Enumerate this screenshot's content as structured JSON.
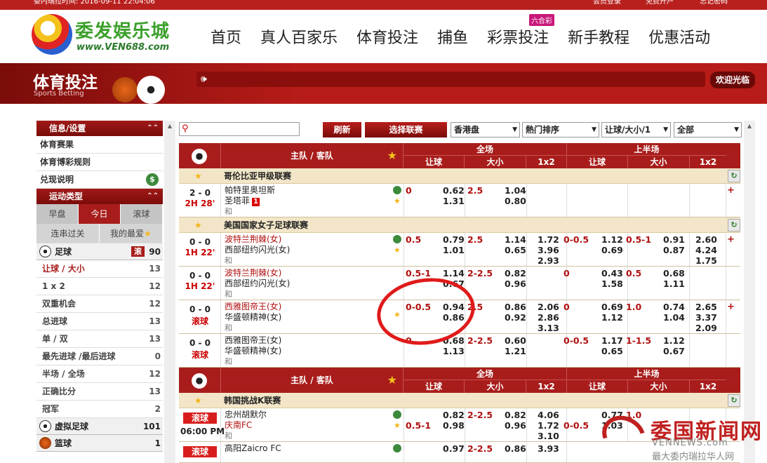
{
  "topbar": {
    "server_time": "委内瑞拉时间: 2016-09-11 22:04:06",
    "links": [
      "会员登录",
      "免费开户",
      "忘记密码"
    ]
  },
  "logo": {
    "name": "委发娱乐城",
    "url": "www.VEN688.com"
  },
  "nav": {
    "items": [
      "首页",
      "真人百家乐",
      "体育投注",
      "捕鱼",
      "彩票投注",
      "新手教程",
      "优惠活动"
    ],
    "badge": "六合彩"
  },
  "banner": {
    "title": "体育投注",
    "subtitle": "Sports Betting",
    "welcome": "欢迎光临"
  },
  "left": {
    "info_title": "信息/设置",
    "info_items": [
      "体育赛果",
      "体育博彩规则",
      "兑现说明"
    ],
    "sport_type_title": "运动类型",
    "tabs": [
      "早盘",
      "今日",
      "滚球"
    ],
    "tabs2": [
      "连串过关",
      "我的最爱"
    ],
    "football": {
      "label": "足球",
      "live_tag": "滚",
      "count": "90"
    },
    "bet_types": [
      {
        "label": "让球 / 大小",
        "count": "13"
      },
      {
        "label": "1 x 2",
        "count": "12"
      },
      {
        "label": "双重机会",
        "count": "12"
      },
      {
        "label": "总进球",
        "count": "13"
      },
      {
        "label": "单 / 双",
        "count": "13"
      },
      {
        "label": "最先进球 /最后进球",
        "count": "0"
      },
      {
        "label": "半场 / 全场",
        "count": "12"
      },
      {
        "label": "正确比分",
        "count": "13"
      },
      {
        "label": "冠军",
        "count": "2"
      }
    ],
    "virtual": {
      "label": "虚拟足球",
      "count": "101"
    },
    "basketball": {
      "label": "篮球",
      "count": "1"
    }
  },
  "toolbar": {
    "refresh": "刷新",
    "select_league": "选择联赛",
    "odds_type": "香港盘",
    "sort": "熱门排序",
    "market": "让球/大小/1",
    "filter": "全部"
  },
  "table": {
    "teams_header": "主队 / 客队",
    "full": "全场",
    "half": "上半场",
    "cols": [
      "让球",
      "大小",
      "1x2",
      "让球",
      "大小",
      "1x2"
    ]
  },
  "leagues": [
    {
      "name": "哥伦比亚甲级联赛"
    },
    {
      "name": "美国国家女子足球联赛"
    },
    {
      "name": "韩国挑战K联赛"
    }
  ],
  "matches": [
    {
      "score": "2 - 0",
      "time": "2H 28'",
      "home": "帕特里奥坦斯",
      "away": "圣塔菲",
      "red_card": "1",
      "draw": "和",
      "hdp_line": "0",
      "hdp_h": "0.62",
      "hdp_a": "1.31",
      "ou_line": "2.5",
      "ou_o": "1.04",
      "ou_u": "0.80"
    },
    {
      "score": "0 - 0",
      "time": "1H 22'",
      "home": "波特兰荆棘(女)",
      "away": "西部纽约闪光(女)",
      "draw": "和",
      "hdp_line": "0.5",
      "hdp_h": "0.79",
      "hdp_a": "1.01",
      "ou_line": "2.5",
      "ou_o": "1.14",
      "ou_u": "0.65",
      "x1": "1.72",
      "x2": "3.96",
      "xd": "2.93",
      "h_hdp_line": "0-0.5",
      "h_hdp_h": "1.12",
      "h_hdp_a": "0.69",
      "h_ou_line": "0.5-1",
      "h_ou_o": "0.91",
      "h_ou_u": "0.87",
      "h_x1": "2.60",
      "h_x2": "4.24",
      "h_xd": "1.75"
    },
    {
      "score": "0 - 0",
      "time": "1H 22'",
      "home": "波特兰荆棘(女)",
      "away": "西部纽约闪光(女)",
      "draw": "和",
      "hdp_line": "0.5-1",
      "hdp_h": "1.14",
      "hdp_a": "0.67",
      "ou_line": "2-2.5",
      "ou_o": "0.82",
      "ou_u": "0.96",
      "h_hdp_line": "0",
      "h_hdp_h": "0.43",
      "h_hdp_a": "1.58",
      "h_ou_line": "0.5",
      "h_ou_o": "0.68",
      "h_ou_u": "1.11"
    },
    {
      "score": "0 - 0",
      "time": "滚球",
      "home": "西雅图帝王(女)",
      "away": "华盛顿精神(女)",
      "draw": "和",
      "hdp_line": "0-0.5",
      "hdp_h": "0.94",
      "hdp_a": "0.86",
      "ou_line": "2.5",
      "ou_o": "0.86",
      "ou_u": "0.92",
      "x1": "2.06",
      "x2": "2.86",
      "xd": "3.13",
      "h_hdp_line": "0",
      "h_hdp_h": "0.69",
      "h_hdp_a": "1.12",
      "h_ou_line": "1.0",
      "h_ou_o": "0.74",
      "h_ou_u": "1.04",
      "h_x1": "2.65",
      "h_x2": "3.37",
      "h_xd": "2.09"
    },
    {
      "score": "0 - 0",
      "time": "滚球",
      "home": "西雅图帝王(女)",
      "away": "华盛顿精神(女)",
      "draw": "和",
      "hdp_line": "0",
      "hdp_h": "0.68",
      "hdp_a": "1.13",
      "ou_line": "2-2.5",
      "ou_o": "0.60",
      "ou_u": "1.21",
      "h_hdp_line": "0-0.5",
      "h_hdp_h": "1.17",
      "h_hdp_a": "0.65",
      "h_ou_line": "1-1.5",
      "h_ou_o": "1.12",
      "h_ou_u": "0.67"
    },
    {
      "bet": "滚球",
      "time": "06:00 PM",
      "home": "忠州胡默尔",
      "away": "庆南FC",
      "draw": "和",
      "hdp_line": "0.5-1",
      "hdp_h": "0.82",
      "hdp_a": "0.98",
      "ou_line": "2-2.5",
      "ou_o": "0.82",
      "ou_u": "0.96",
      "x1": "4.06",
      "x2": "1.72",
      "xd": "3.10",
      "h_hdp_line": "0-0.5",
      "h_hdp_h": "0.77",
      "h_hdp_a": "1.03",
      "h_ou_line": "1.0"
    },
    {
      "bet": "滚球",
      "home": "高阳Zaicro FC",
      "hdp_h": "0.97",
      "ou_line": "2-2.5",
      "ou_o": "0.86",
      "x1": "3.93"
    }
  ],
  "watermark": {
    "title": "委国新闻网",
    "url": "VENNEWS.com",
    "slogan": "最大委内瑞拉华人网"
  }
}
